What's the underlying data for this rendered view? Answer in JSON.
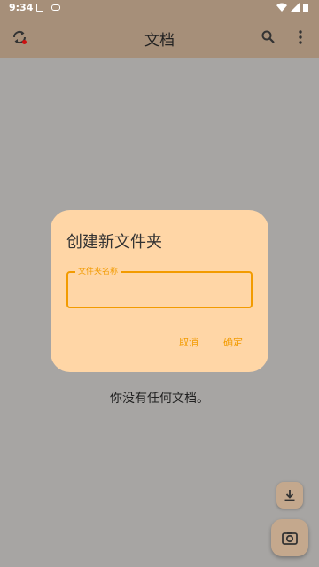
{
  "status_bar": {
    "time": "9:34"
  },
  "app_bar": {
    "title": "文档"
  },
  "empty_state": {
    "message": "你没有任何文档。"
  },
  "dialog": {
    "title": "创建新文件夹",
    "field_label": "文件夹名称",
    "field_value": "",
    "cancel_label": "取消",
    "ok_label": "确定"
  },
  "icons": {
    "sync": "sync-icon",
    "search": "search-icon",
    "more": "more-vert-icon",
    "import": "download-icon",
    "camera": "camera-icon"
  },
  "colors": {
    "app_bar": "#a68f79",
    "dialog_bg": "#ffd6a6",
    "accent": "#f29b00",
    "fab": "#c4a88d"
  }
}
